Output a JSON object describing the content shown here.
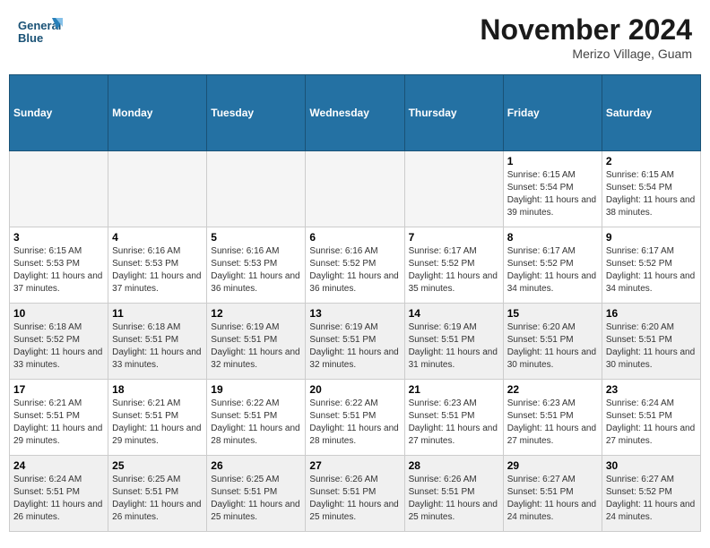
{
  "header": {
    "logo_text1": "General",
    "logo_text2": "Blue",
    "month_title": "November 2024",
    "subtitle": "Merizo Village, Guam"
  },
  "days_of_week": [
    "Sunday",
    "Monday",
    "Tuesday",
    "Wednesday",
    "Thursday",
    "Friday",
    "Saturday"
  ],
  "weeks": [
    [
      {
        "day": "",
        "info": "",
        "empty": true
      },
      {
        "day": "",
        "info": "",
        "empty": true
      },
      {
        "day": "",
        "info": "",
        "empty": true
      },
      {
        "day": "",
        "info": "",
        "empty": true
      },
      {
        "day": "",
        "info": "",
        "empty": true
      },
      {
        "day": "1",
        "info": "Sunrise: 6:15 AM\nSunset: 5:54 PM\nDaylight: 11 hours and 39 minutes."
      },
      {
        "day": "2",
        "info": "Sunrise: 6:15 AM\nSunset: 5:54 PM\nDaylight: 11 hours and 38 minutes."
      }
    ],
    [
      {
        "day": "3",
        "info": "Sunrise: 6:15 AM\nSunset: 5:53 PM\nDaylight: 11 hours and 37 minutes."
      },
      {
        "day": "4",
        "info": "Sunrise: 6:16 AM\nSunset: 5:53 PM\nDaylight: 11 hours and 37 minutes."
      },
      {
        "day": "5",
        "info": "Sunrise: 6:16 AM\nSunset: 5:53 PM\nDaylight: 11 hours and 36 minutes."
      },
      {
        "day": "6",
        "info": "Sunrise: 6:16 AM\nSunset: 5:52 PM\nDaylight: 11 hours and 36 minutes."
      },
      {
        "day": "7",
        "info": "Sunrise: 6:17 AM\nSunset: 5:52 PM\nDaylight: 11 hours and 35 minutes."
      },
      {
        "day": "8",
        "info": "Sunrise: 6:17 AM\nSunset: 5:52 PM\nDaylight: 11 hours and 34 minutes."
      },
      {
        "day": "9",
        "info": "Sunrise: 6:17 AM\nSunset: 5:52 PM\nDaylight: 11 hours and 34 minutes."
      }
    ],
    [
      {
        "day": "10",
        "info": "Sunrise: 6:18 AM\nSunset: 5:52 PM\nDaylight: 11 hours and 33 minutes.",
        "shaded": true
      },
      {
        "day": "11",
        "info": "Sunrise: 6:18 AM\nSunset: 5:51 PM\nDaylight: 11 hours and 33 minutes.",
        "shaded": true
      },
      {
        "day": "12",
        "info": "Sunrise: 6:19 AM\nSunset: 5:51 PM\nDaylight: 11 hours and 32 minutes.",
        "shaded": true
      },
      {
        "day": "13",
        "info": "Sunrise: 6:19 AM\nSunset: 5:51 PM\nDaylight: 11 hours and 32 minutes.",
        "shaded": true
      },
      {
        "day": "14",
        "info": "Sunrise: 6:19 AM\nSunset: 5:51 PM\nDaylight: 11 hours and 31 minutes.",
        "shaded": true
      },
      {
        "day": "15",
        "info": "Sunrise: 6:20 AM\nSunset: 5:51 PM\nDaylight: 11 hours and 30 minutes.",
        "shaded": true
      },
      {
        "day": "16",
        "info": "Sunrise: 6:20 AM\nSunset: 5:51 PM\nDaylight: 11 hours and 30 minutes.",
        "shaded": true
      }
    ],
    [
      {
        "day": "17",
        "info": "Sunrise: 6:21 AM\nSunset: 5:51 PM\nDaylight: 11 hours and 29 minutes."
      },
      {
        "day": "18",
        "info": "Sunrise: 6:21 AM\nSunset: 5:51 PM\nDaylight: 11 hours and 29 minutes."
      },
      {
        "day": "19",
        "info": "Sunrise: 6:22 AM\nSunset: 5:51 PM\nDaylight: 11 hours and 28 minutes."
      },
      {
        "day": "20",
        "info": "Sunrise: 6:22 AM\nSunset: 5:51 PM\nDaylight: 11 hours and 28 minutes."
      },
      {
        "day": "21",
        "info": "Sunrise: 6:23 AM\nSunset: 5:51 PM\nDaylight: 11 hours and 27 minutes."
      },
      {
        "day": "22",
        "info": "Sunrise: 6:23 AM\nSunset: 5:51 PM\nDaylight: 11 hours and 27 minutes."
      },
      {
        "day": "23",
        "info": "Sunrise: 6:24 AM\nSunset: 5:51 PM\nDaylight: 11 hours and 27 minutes."
      }
    ],
    [
      {
        "day": "24",
        "info": "Sunrise: 6:24 AM\nSunset: 5:51 PM\nDaylight: 11 hours and 26 minutes.",
        "shaded": true
      },
      {
        "day": "25",
        "info": "Sunrise: 6:25 AM\nSunset: 5:51 PM\nDaylight: 11 hours and 26 minutes.",
        "shaded": true
      },
      {
        "day": "26",
        "info": "Sunrise: 6:25 AM\nSunset: 5:51 PM\nDaylight: 11 hours and 25 minutes.",
        "shaded": true
      },
      {
        "day": "27",
        "info": "Sunrise: 6:26 AM\nSunset: 5:51 PM\nDaylight: 11 hours and 25 minutes.",
        "shaded": true
      },
      {
        "day": "28",
        "info": "Sunrise: 6:26 AM\nSunset: 5:51 PM\nDaylight: 11 hours and 25 minutes.",
        "shaded": true
      },
      {
        "day": "29",
        "info": "Sunrise: 6:27 AM\nSunset: 5:51 PM\nDaylight: 11 hours and 24 minutes.",
        "shaded": true
      },
      {
        "day": "30",
        "info": "Sunrise: 6:27 AM\nSunset: 5:52 PM\nDaylight: 11 hours and 24 minutes.",
        "shaded": true
      }
    ]
  ]
}
